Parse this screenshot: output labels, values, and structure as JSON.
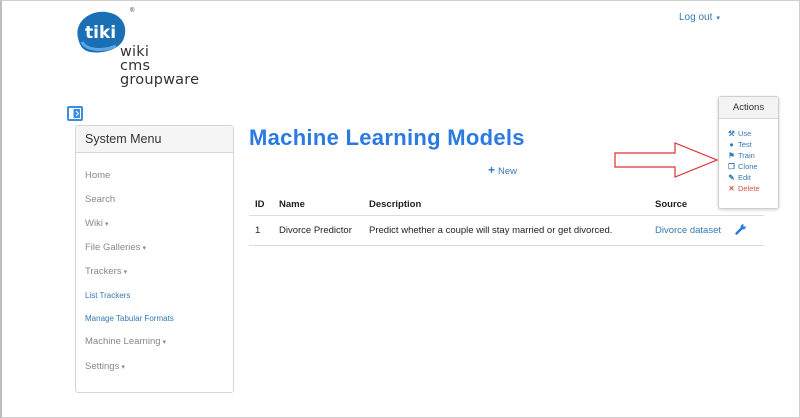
{
  "logo": {
    "badge": "tiki",
    "registered": "®",
    "lines": [
      "wiki",
      "cms",
      "groupware"
    ]
  },
  "header": {
    "logout_label": "Log out",
    "logout_caret": "▾"
  },
  "sidebar": {
    "title": "System Menu",
    "items": [
      {
        "label": "Home",
        "caret": ""
      },
      {
        "label": "Search",
        "caret": ""
      },
      {
        "label": "Wiki",
        "caret": "▾"
      },
      {
        "label": "File Galleries",
        "caret": "▾"
      },
      {
        "label": "Trackers",
        "caret": "▾"
      },
      {
        "label": "List Trackers",
        "caret": ""
      },
      {
        "label": "Manage Tabular Formats",
        "caret": ""
      },
      {
        "label": "Machine Learning",
        "caret": "▾"
      },
      {
        "label": "Settings",
        "caret": "▾"
      }
    ]
  },
  "main": {
    "title": "Machine Learning Models",
    "new_label": "New",
    "new_icon": "+",
    "columns": [
      "ID",
      "Name",
      "Description",
      "Source"
    ],
    "rows": [
      {
        "id": "1",
        "name": "Divorce Predictor",
        "description": "Predict whether a couple will stay married or get divorced.",
        "source": "Divorce dataset"
      }
    ]
  },
  "actions": {
    "title": "Actions",
    "items": [
      {
        "label": "Use",
        "icon": "hammer-icon",
        "glyph": "⚒"
      },
      {
        "label": "Test",
        "icon": "circle-play-icon",
        "glyph": "●"
      },
      {
        "label": "Train",
        "icon": "train-icon",
        "glyph": "⚑"
      },
      {
        "label": "Clone",
        "icon": "clone-icon",
        "glyph": "❐"
      },
      {
        "label": "Edit",
        "icon": "edit-icon",
        "glyph": "✎"
      },
      {
        "label": "Delete",
        "icon": "delete-icon",
        "glyph": "✕"
      }
    ]
  },
  "colors": {
    "link": "#337ab7",
    "title": "#2a7ae2",
    "danger": "#d9534f",
    "arrow": "#e03030",
    "logo": "#1a6fb5"
  }
}
